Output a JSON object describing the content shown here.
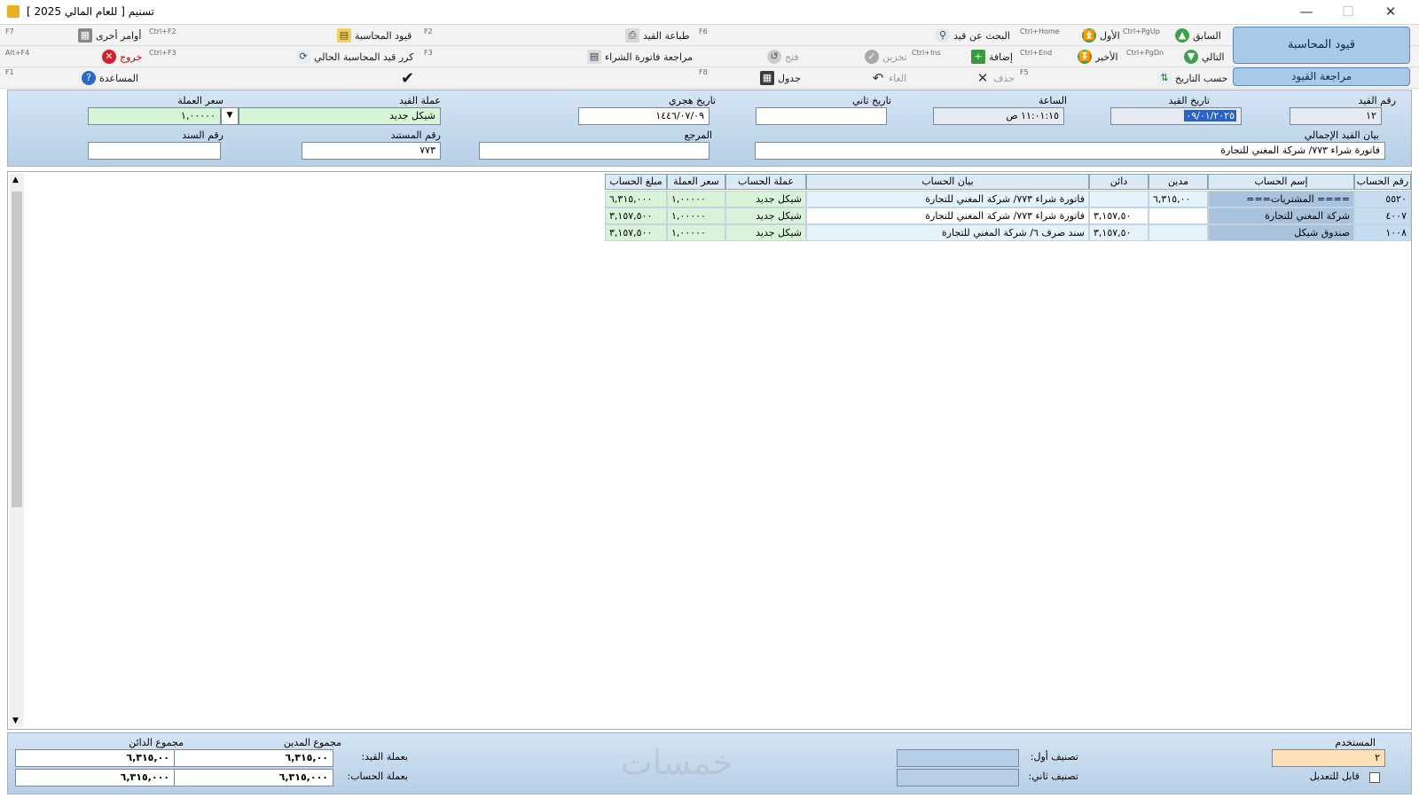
{
  "window": {
    "title": "تسنيم  [ للعام المالي 2025 ]",
    "minimize": "—",
    "maximize": "☐",
    "close": "✕"
  },
  "toolbar": {
    "row1": {
      "previous": "السابق",
      "previous_sc": "Ctrl+PgUp",
      "first": "الأول",
      "search": "البحث عن قيد",
      "search_sc": "Ctrl+Home",
      "print": "طباعة القيد",
      "print_sc": "F6",
      "accounting_entries": "قيود المحاسبة",
      "accounting_entries_sc": "F2",
      "other_commands": "أوامر أخرى",
      "other_commands_sc": "Ctrl+F2",
      "f7": "F7"
    },
    "row2": {
      "next": "التالي",
      "next_sc": "Ctrl+PgDn",
      "last": "الأخير",
      "add": "إضافة",
      "add_sc": "Ctrl+End",
      "store": "تخزين",
      "store_sc": "Ctrl+Ins",
      "open": "فتح",
      "purchase_review": "مراجعة فاتورة الشراء",
      "repeat": "كرر قيد المحاسبة الحالي",
      "repeat_sc": "F3",
      "exit": "خروج",
      "exit_sc": "Ctrl+F3",
      "altf4": "Alt+F4"
    },
    "row3": {
      "by_date": "حسب التاريخ",
      "delete": "حذف",
      "delete_sc": "F5",
      "cancel": "الغاء",
      "table": "جدول",
      "table_sc": "F8",
      "help": "المساعدة",
      "help_sc": "F1"
    },
    "big_buttons": {
      "entries": "قيود المحاسبة",
      "review_entries": "مراجعة القيود"
    }
  },
  "form": {
    "entry_no": {
      "label": "رقم القيد",
      "value": "١٢"
    },
    "entry_date": {
      "label": "تاريخ القيد",
      "value": "٠٩/٠١/٢٠٢٥"
    },
    "time": {
      "label": "الساعة",
      "value": "١١:٠١:١٥ ص"
    },
    "second_date": {
      "label": "تاريخ ثاني",
      "value": ""
    },
    "hijri_date": {
      "label": "تاريخ هجري",
      "value": "١٤٤٦/٠٧/٠٩"
    },
    "entry_currency": {
      "label": "عملة القيد",
      "value": "شيكل جديد"
    },
    "currency_rate": {
      "label": "سعر العملة",
      "value": "١,٠٠٠٠٠"
    },
    "description": {
      "label": "بيان القيد الإجمالي",
      "value": "فاتورة شراء ٧٧٣/ شركة المغني للتجارة"
    },
    "reference": {
      "label": "المرجع",
      "value": ""
    },
    "document_no": {
      "label": "رقم المستند",
      "value": "٧٧٣"
    },
    "voucher_no": {
      "label": "رقم السند",
      "value": ""
    }
  },
  "grid": {
    "headers": [
      "رقم الحساب",
      "إسم الحساب",
      "مدين",
      "دائن",
      "بيان الحساب",
      "عملة الحساب",
      "سعر العملة",
      "مبلغ الحساب"
    ],
    "rows": [
      [
        "٥٥٢٠",
        "==== المشتريات===",
        "٦,٣١٥,٠٠",
        "",
        "فاتورة شراء ٧٧٣/ شركة المغني للتجارة",
        "شيكل جديد",
        "١,٠٠٠٠٠",
        "٦,٣١٥,٠٠٠"
      ],
      [
        "٤٠٠٧",
        "شركة المغني للتجارة",
        "",
        "٣,١٥٧,٥٠",
        "فاتورة شراء ٧٧٣/ شركة المغني للتجارة",
        "شيكل جديد",
        "١,٠٠٠٠٠",
        "٣,١٥٧,٥٠٠"
      ],
      [
        "١٠٠٨",
        "صندوق شيكل",
        "",
        "٣,١٥٧,٥٠",
        "سند صرف ٦/ شركة المغني للتجارة",
        "شيكل جديد",
        "١,٠٠٠٠٠",
        "٣,١٥٧,٥٠٠"
      ]
    ]
  },
  "footer": {
    "user_label": "المستخدم",
    "user_value": "٢",
    "editable_label": "قابل للتعديل",
    "class1_label": "تصنيف أول:",
    "class2_label": "تصنيف ثاني:",
    "debit_total_label": "مجموع المدين",
    "credit_total_label": "مجموع الدائن",
    "in_entry_currency": "بعملة القيد:",
    "in_account_currency": "بعملة الحساب:",
    "debit_entry": "٦,٣١٥,٠٠",
    "credit_entry": "٦,٣١٥,٠٠",
    "debit_account": "٦,٣١٥,٠٠٠",
    "credit_account": "٦,٣١٥,٠٠٠",
    "watermark": "خمسات"
  }
}
